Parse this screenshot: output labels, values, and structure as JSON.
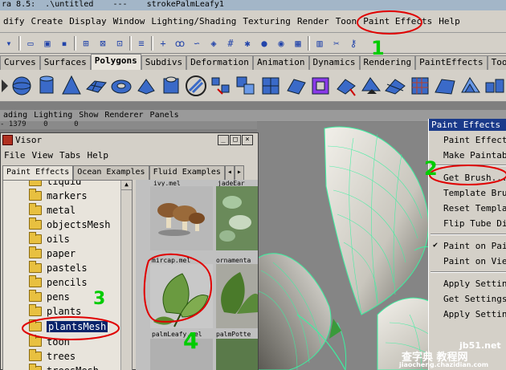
{
  "window": {
    "title": "ra 8.5:  .\\untitled    ---    strokePalmLeafy1"
  },
  "menubar": {
    "items": [
      "dify",
      "Create",
      "Display",
      "Window",
      "Lighting/Shading",
      "Texturing",
      "Render",
      "Toon",
      "Paint Effects",
      "Help"
    ]
  },
  "shelf": {
    "tabs": [
      "Curves",
      "Surfaces",
      "Polygons",
      "Subdivs",
      "Deformation",
      "Animation",
      "Dynamics",
      "Rendering",
      "PaintEffects",
      "Toon"
    ],
    "active_tab": "Polygons"
  },
  "panel": {
    "menus": [
      "ading",
      "Lighting",
      "Show",
      "Renderer",
      "Panels"
    ],
    "coord_readout": "- 1379    0      0"
  },
  "visor": {
    "title": "Visor",
    "menus": [
      "File",
      "View",
      "Tabs",
      "Help"
    ],
    "tabs": [
      "Paint Effects",
      "Ocean Examples",
      "Fluid Examples"
    ],
    "folders": [
      "liquid",
      "markers",
      "metal",
      "objectsMesh",
      "oils",
      "paper",
      "pastels",
      "pencils",
      "pens",
      "plants",
      "plantsMesh",
      "toon",
      "trees",
      "treesMesh"
    ],
    "selected_folder": "plantsMesh",
    "thumbnails": [
      {
        "top_label": "ivy.mel",
        "bottom_label": "",
        "kind": "mushroom"
      },
      {
        "top_label": "jadeEar",
        "bottom_label": "",
        "kind": "leaves"
      },
      {
        "top_label": "mircap.mel",
        "bottom_label": "palmLeafy.mel",
        "kind": "leaf"
      },
      {
        "top_label": "ornamenta",
        "bottom_label": "palmPotte",
        "kind": "leaves"
      }
    ]
  },
  "paint_effects_menu": {
    "header": "Paint Effects",
    "items": [
      "Paint Effects",
      "Make Paintabl",
      "Get Brush...",
      "Template Brus",
      "Reset Templat",
      "Flip Tube Dir",
      "Paint on Pain",
      "Paint on View",
      "Apply Setting",
      "Get Settings",
      "Apply Setting"
    ],
    "checked_item": "Paint on Pain"
  },
  "annotations": {
    "step1": "1",
    "step2": "2",
    "step3": "3",
    "step4": "4",
    "color": "#e00000",
    "step_color": "#00cc00"
  },
  "watermark": {
    "line1": "jb51.net",
    "line2": "查字典 教程网",
    "line3": "jiaocheng.chazidian.com"
  }
}
